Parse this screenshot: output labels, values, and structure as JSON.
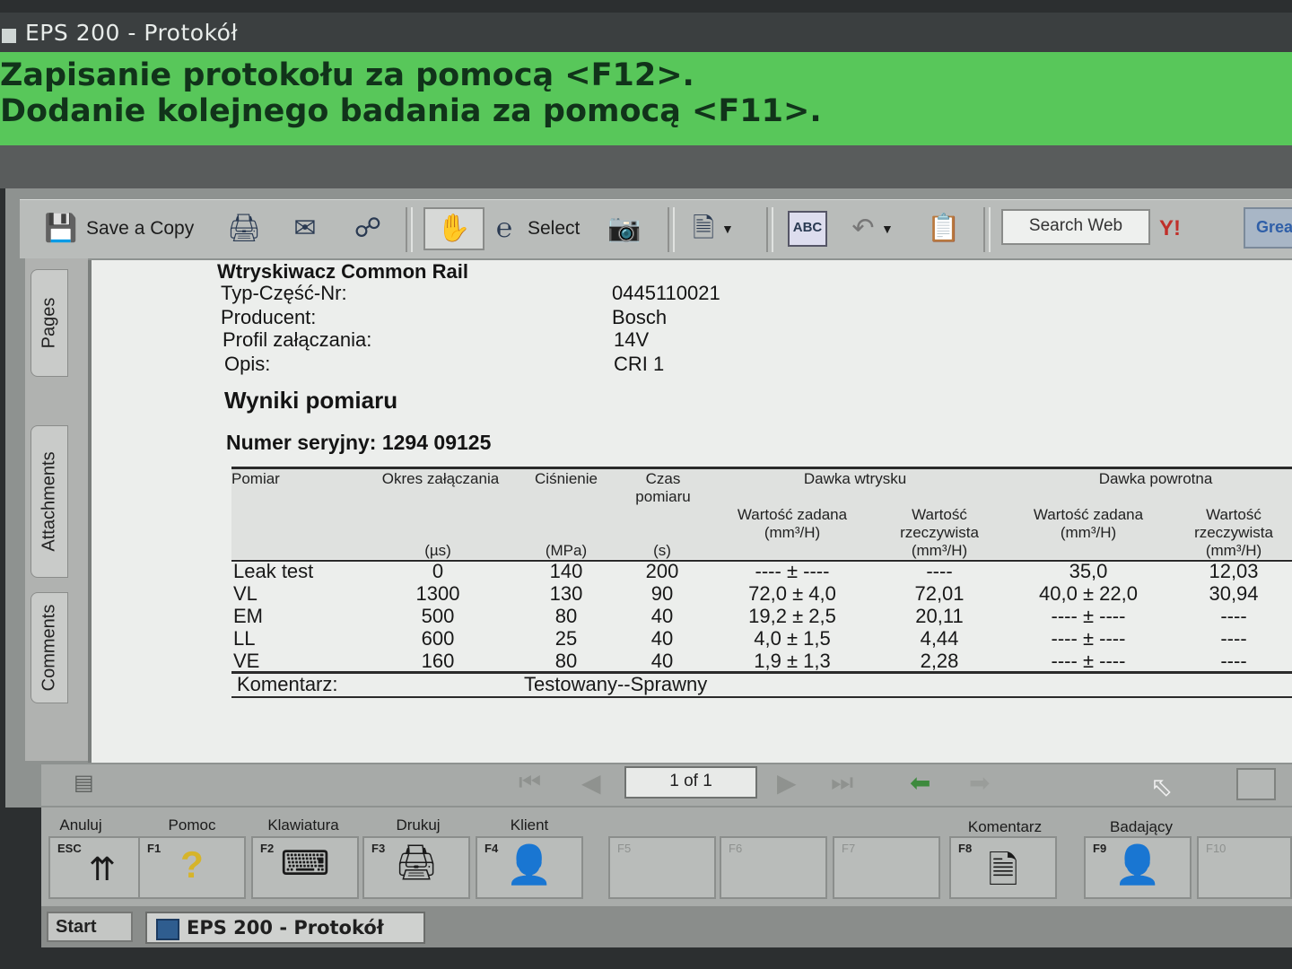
{
  "window": {
    "title": "EPS 200 - Protokół"
  },
  "banner": {
    "line1": "Zapisanie protokołu za pomocą <F12>.",
    "line2": "Dodanie kolejnego badania za pomocą <F11>."
  },
  "toolbar": {
    "save_copy_label": "Save a Copy",
    "select_label": "Select",
    "search_web_label": "Search Web",
    "grea_label": "Grea"
  },
  "side_tabs": [
    "Pages",
    "Attachments",
    "Comments"
  ],
  "document": {
    "heading": "Wtryskiwacz Common Rail",
    "fields": [
      {
        "label": "Typ-Część-Nr:",
        "value": "0445110021"
      },
      {
        "label": "Producent:",
        "value": "Bosch"
      },
      {
        "label": "Profil załączania:",
        "value": "14V"
      },
      {
        "label": "Opis:",
        "value": "CRI 1"
      }
    ],
    "results_title": "Wyniki pomiaru",
    "serial": "Numer seryjny: 1294 09125",
    "table": {
      "headers": {
        "pomiar": "Pomiar",
        "okres": "Okres załączania",
        "cisnienie": "Ciśnienie",
        "czas": "Czas pomiaru",
        "dawka_wtrysku": "Dawka wtrysku",
        "dawka_powrotna": "Dawka powrotna",
        "wartosc_zadana": "Wartość zadana (mm³/H)",
        "wartosc_rzecz": "Wartość rzeczywista (mm³/H)",
        "unit_us": "(µs)",
        "unit_mpa": "(MPa)",
        "unit_s": "(s)"
      },
      "rows": [
        [
          "Leak test",
          "0",
          "140",
          "200",
          "---- ± ----",
          "----",
          "35,0",
          "12,03"
        ],
        [
          "VL",
          "1300",
          "130",
          "90",
          "72,0 ± 4,0",
          "72,01",
          "40,0 ± 22,0",
          "30,94"
        ],
        [
          "EM",
          "500",
          "80",
          "40",
          "19,2 ± 2,5",
          "20,11",
          "---- ± ----",
          "----"
        ],
        [
          "LL",
          "600",
          "25",
          "40",
          "4,0 ± 1,5",
          "4,44",
          "---- ± ----",
          "----"
        ],
        [
          "VE",
          "160",
          "80",
          "40",
          "1,9 ± 1,3",
          "2,28",
          "---- ± ----",
          "----"
        ]
      ],
      "comment_label": "Komentarz:",
      "comment_value": "Testowany--Sprawny"
    }
  },
  "nav": {
    "page_indicator": "1 of 1"
  },
  "function_keys": [
    {
      "label": "Anuluj",
      "key": "ESC",
      "icon": "chevrons-up-icon"
    },
    {
      "label": "Pomoc",
      "key": "F1",
      "icon": "question-icon"
    },
    {
      "label": "Klawiatura",
      "key": "F2",
      "icon": "keyboard-icon"
    },
    {
      "label": "Drukuj",
      "key": "F3",
      "icon": "printer-icon"
    },
    {
      "label": "Klient",
      "key": "F4",
      "icon": "person-icon"
    },
    {
      "label": "",
      "key": "F5",
      "icon": ""
    },
    {
      "label": "",
      "key": "F6",
      "icon": ""
    },
    {
      "label": "",
      "key": "F7",
      "icon": ""
    },
    {
      "label": "Komentarz",
      "key": "F8",
      "icon": "document-icon"
    },
    {
      "label": "Badający",
      "key": "F9",
      "icon": "person-icon"
    },
    {
      "label": "",
      "key": "F10",
      "icon": ""
    }
  ],
  "taskbar": {
    "start_label": "Start",
    "task_label": "EPS 200 - Protokół"
  }
}
